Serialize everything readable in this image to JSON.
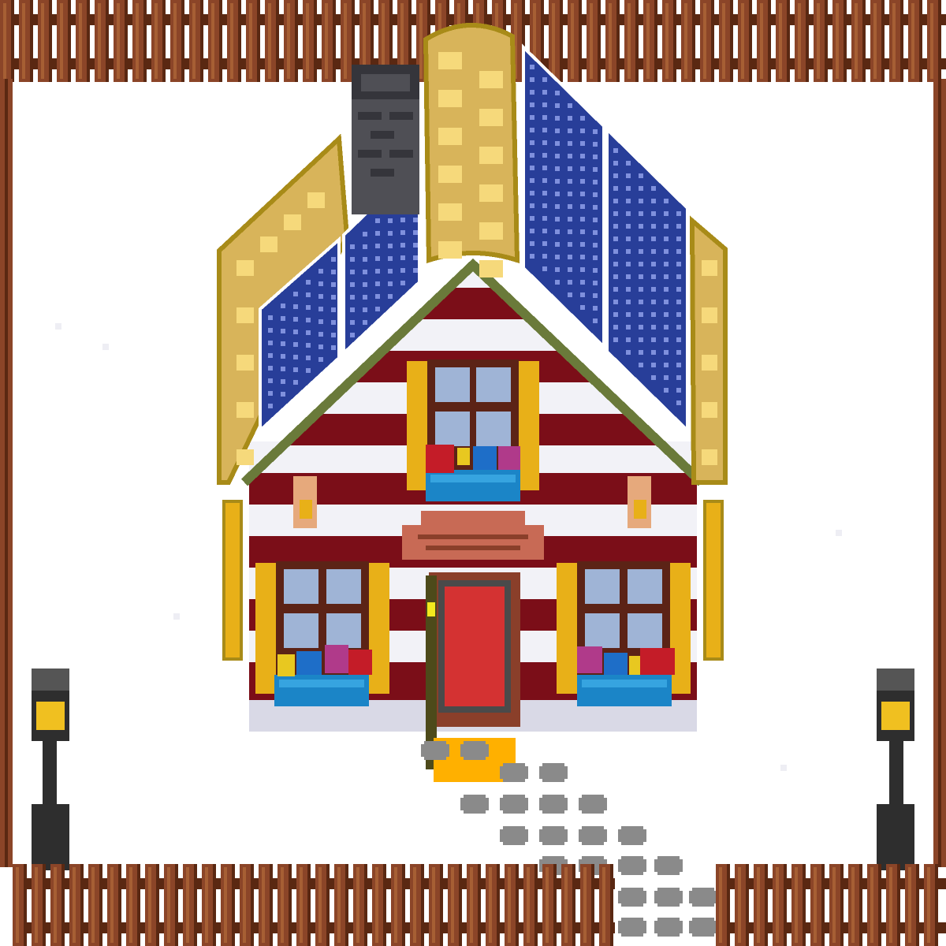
{
  "scene": {
    "title": "",
    "colors": {
      "snow": "#ffffff",
      "snow_shadow": "#d9d9e6",
      "fence_wood": "#8b4528",
      "fence_dark": "#5a2812",
      "fence_light": "#a65f34",
      "roof_gold": "#d8b45a",
      "roof_light": "#f6d97b",
      "roof_outline": "#a88b18",
      "solar_blue": "#283e99",
      "solar_dot": "#7f90dd",
      "chimney": "#4f4f55",
      "chimney_dark": "#35353b",
      "stripe_red": "#7b0e18",
      "stripe_white": "#f2f2f7",
      "trim_green": "#6a7a3a",
      "shutter_gold": "#e8b018",
      "window_frame": "#5c2316",
      "pane": "#9fb4d6",
      "planter_blue": "#1b85c7",
      "door_red": "#d43232",
      "brick": "#8a3f2a",
      "awning": "#c86a55",
      "doormat": "#ffb000",
      "step_gray": "#8a8a8a",
      "lamp_post": "#2e2e2e",
      "lamp_light": "#f0c020",
      "wall_lamp": "#e6a97c"
    },
    "icons": [
      "house-icon",
      "solar-panel-icon",
      "chimney-icon",
      "window-icon",
      "flower-box-icon",
      "door-icon",
      "doormat-icon",
      "street-lamp-icon",
      "wall-lamp-icon",
      "fence-icon",
      "footprint-icon"
    ]
  }
}
